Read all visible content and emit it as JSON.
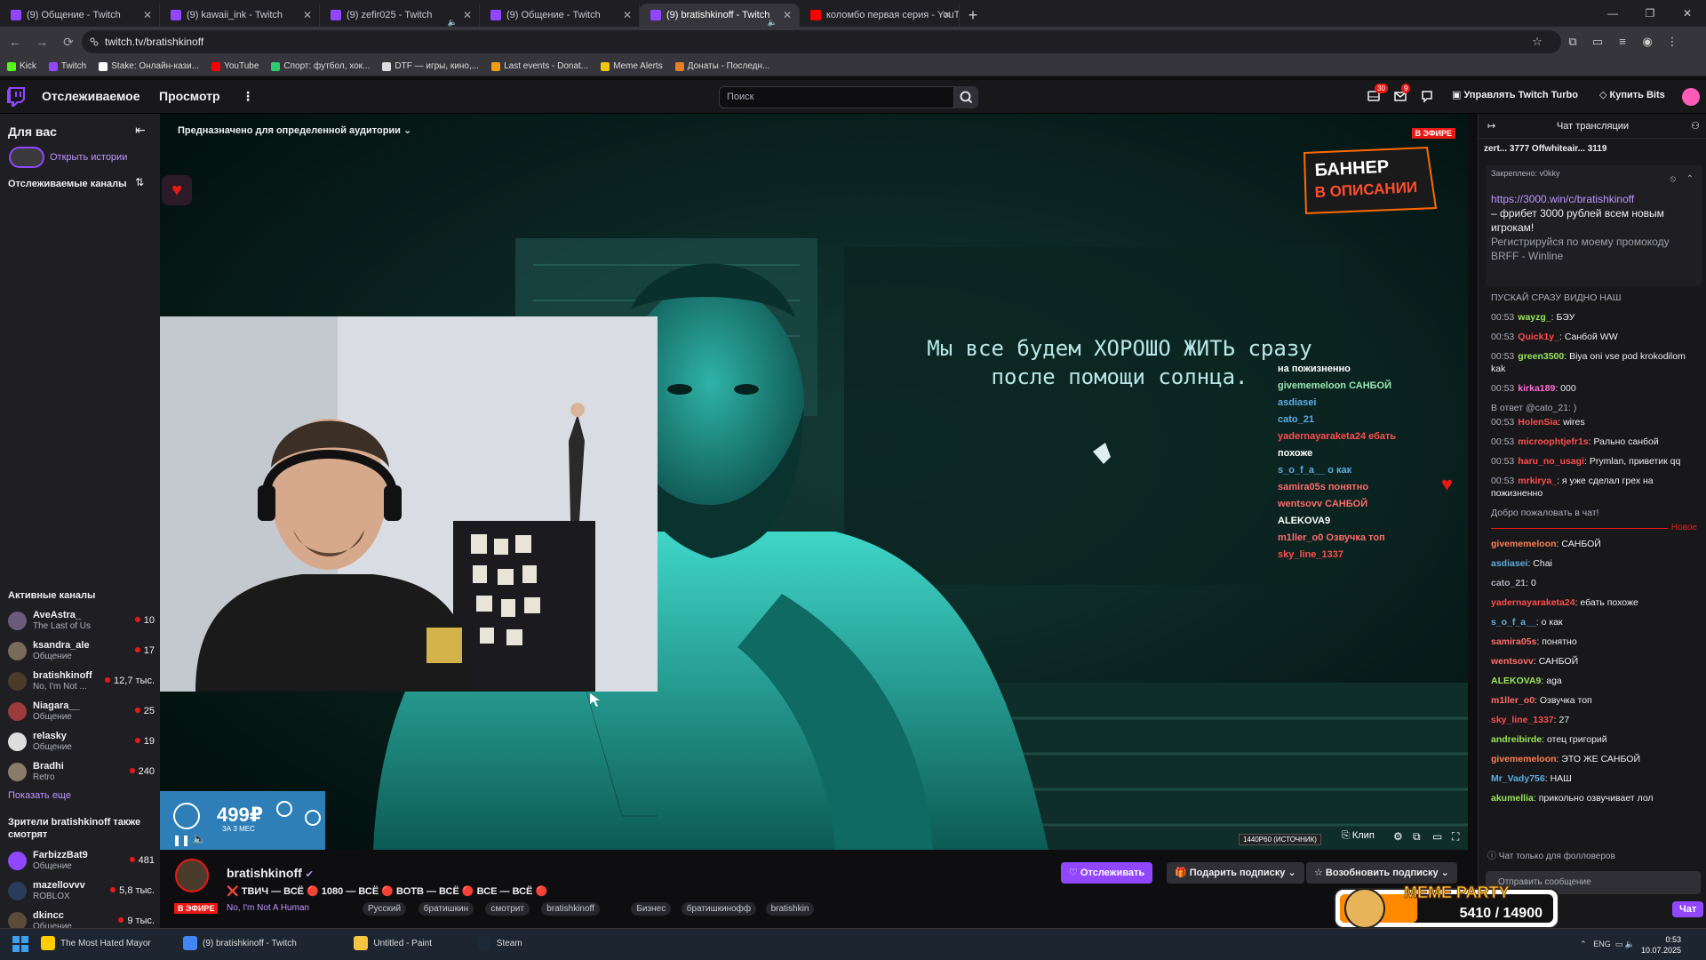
{
  "browser": {
    "tabs": [
      {
        "label": "(9) Общение - Twitch",
        "fav": "#9147ff",
        "active": false,
        "audio": false
      },
      {
        "label": "(9) kawaii_ink - Twitch",
        "fav": "#9147ff",
        "active": false,
        "audio": false
      },
      {
        "label": "(9) zefir025 - Twitch",
        "fav": "#9147ff",
        "active": false,
        "audio": true
      },
      {
        "label": "(9) Общение - Twitch",
        "fav": "#9147ff",
        "active": false,
        "audio": false
      },
      {
        "label": "(9) bratishkinoff - Twitch",
        "fav": "#9147ff",
        "active": true,
        "audio": true
      },
      {
        "label": "коломбо первая серия - YouTube",
        "fav": "#ff0000",
        "active": false,
        "audio": false
      }
    ],
    "new_tab": "+",
    "url": "twitch.tv/bratishkinoff",
    "bookmarks": [
      {
        "label": "Kick",
        "color": "#53fc18"
      },
      {
        "label": "Twitch",
        "color": "#9147ff"
      },
      {
        "label": "Stake: Онлайн-кази...",
        "color": "#ffffff"
      },
      {
        "label": "YouTube",
        "color": "#ff0000"
      },
      {
        "label": "Спорт: футбол, хок...",
        "color": "#2ecc71"
      },
      {
        "label": "DTF — игры, кино,...",
        "color": "#dddddd"
      },
      {
        "label": "Last events - Donat...",
        "color": "#f39c12"
      },
      {
        "label": "Meme Alerts",
        "color": "#f1c40f"
      },
      {
        "label": "Донаты - Последн...",
        "color": "#e67e22"
      }
    ]
  },
  "twitch_nav": {
    "following": "Отслеживаемое",
    "browse": "Просмотр",
    "more": "⋮",
    "search_placeholder": "Поиск",
    "notif_count": "30",
    "inbox_count": "9",
    "turbo": "Управлять Twitch Turbo",
    "bits": "Купить Bits"
  },
  "sidebar": {
    "title": "Для вас",
    "stories": "Открыть истории",
    "followed_label": "Отслеживаемые каналы",
    "active_label": "Активные каналы",
    "active": [
      {
        "name": "AveAstra_",
        "category": "The Last of Us",
        "viewers": "10",
        "color": "#6b5b7b"
      },
      {
        "name": "ksandra_ale",
        "category": "Общение",
        "viewers": "17",
        "color": "#7a6a5a"
      },
      {
        "name": "bratishkinoff",
        "category": "No, I'm Not ...",
        "viewers": "12,7 тыс.",
        "color": "#4a3b2b"
      },
      {
        "name": "Niagara__",
        "category": "Общение",
        "viewers": "25",
        "color": "#9c3b3b"
      },
      {
        "name": "relasky",
        "category": "Общение",
        "viewers": "19",
        "color": "#dddddd"
      },
      {
        "name": "Bradhi",
        "category": "Retro",
        "viewers": "240",
        "color": "#8a7a6a"
      }
    ],
    "show_more": "Показать еще",
    "viewers_also_label": "Зрители bratishkinoff также смотрят",
    "also": [
      {
        "name": "FarbizzBat9",
        "category": "Общение",
        "viewers": "481",
        "color": "#9147ff"
      },
      {
        "name": "mazellovvv",
        "category": "ROBLOX",
        "viewers": "5,8 тыс.",
        "color": "#2b3b5b"
      },
      {
        "name": "dkincc",
        "category": "Общение",
        "viewers": "9 тыс.",
        "color": "#5b4b3b"
      }
    ]
  },
  "video": {
    "audience": "Предназначено для определенной аудитории",
    "live": "В ЭФИРЕ",
    "banner_line1": "БАННЕР",
    "banner_line2": "В ОПИСАНИИ",
    "caption_line1": "Мы все будем ХОРОШО ЖИТЬ сразу",
    "caption_line2": "после помощи солнца.",
    "overlay_chat": [
      {
        "text": "на пожизненно",
        "color": "#ffffff"
      },
      {
        "text": "givememeloon САНБОЙ",
        "color": "#9ae6b4"
      },
      {
        "text": "asdiasei",
        "color": "#5dade2"
      },
      {
        "text": "cato_21",
        "color": "#5dade2"
      },
      {
        "text": "yadernayaraketa24 ебать",
        "color": "#ff4d4d"
      },
      {
        "text": "похоже",
        "color": "#ffffff"
      },
      {
        "text": "s_o_f_a__ о как",
        "color": "#5dade2"
      },
      {
        "text": "samira05s понятно",
        "color": "#ff6b6b"
      },
      {
        "text": "wentsovv САНБОЙ",
        "color": "#ff6b6b"
      },
      {
        "text": "ALEKOVA9",
        "color": "#ffffff"
      },
      {
        "text": "m1ller_o0 Озвучка топ",
        "color": "#ff6b6b"
      },
      {
        "text": "sky_line_1337",
        "color": "#ff4d4d"
      }
    ],
    "ad_price": "499₽",
    "ad_sub": "ЗА 3 МЕС",
    "quality": "1440P60 (ИСТОЧНИК)",
    "clip": "Клип"
  },
  "stream_info": {
    "live": "В ЭФИРЕ",
    "name": "bratishkinoff",
    "title": "❌ ТВИЧ — ВСЁ 🔴 1080 — ВСЁ 🔴 ВОТВ — ВСЁ 🔴 ВСЕ — ВСЁ 🔴",
    "game": "No, I'm Not A Human",
    "tags": [
      "Русский",
      "братишкин",
      "смотрит",
      "bratishkinoff",
      "Бизнес",
      "братишкинофф",
      "bratishkin"
    ],
    "follow": "Отслеживать",
    "gift": "Подарить подписку",
    "resub": "Возобновить подписку"
  },
  "chat": {
    "header": "Чат трансляции",
    "gifts": "zert... 3777   Offwhiteair... 3119",
    "pinned_label": "Закреплено: v0kky",
    "pinned_link": "https://3000.win/c/bratishkinoff",
    "pinned_text": "– фрибет 3000 рублей всем новым игрокам!",
    "pinned_fade": "Регистрируйся по моему промокоду BRFF - Winline",
    "cut_line": "ПУСКАЙ СРАЗУ ВИДНО НАШ",
    "messages_top": [
      {
        "time": "00:53",
        "user": "wayzg_",
        "color": "#9ae65a",
        "text": "БЭУ"
      },
      {
        "time": "00:53",
        "user": "Quick1y_",
        "color": "#ff4d4d",
        "text": "Санбой WW"
      },
      {
        "time": "00:53",
        "user": "green3500",
        "color": "#9ae65a",
        "text": "Biya oni vse pod krokodilom kak"
      },
      {
        "time": "00:53",
        "user": "kirka189",
        "color": "#ff6bd6",
        "text": "000"
      },
      {
        "time": "00:53",
        "user": "HolenSia",
        "color": "#ff4d4d",
        "text": "wires"
      },
      {
        "time": "00:53",
        "user": "microophtjefr1s",
        "color": "#ff4d4d",
        "text": "Рально санбой"
      },
      {
        "time": "00:53",
        "user": "haru_no_usagi",
        "color": "#ff4d4d",
        "text": "Prymlan, приветик qq"
      },
      {
        "time": "00:53",
        "user": "mrkirya_",
        "color": "#ff4d4d",
        "text": "я уже сделал грех на пожизненно"
      }
    ],
    "reply_note": "В ответ @cato_21: )",
    "welcome": "Добро пожаловать в чат!",
    "new_label": "Новое",
    "messages_bottom": [
      {
        "user": "givememeloon",
        "color": "#ff7f50",
        "text": "САНБОЙ"
      },
      {
        "user": "asdiasei",
        "color": "#5dade2",
        "text": "Chai"
      },
      {
        "user": "cato_21",
        "color": "#adadb8",
        "text": "0"
      },
      {
        "user": "yadernayaraketa24",
        "color": "#ff4d4d",
        "text": "ебать похоже"
      },
      {
        "user": "s_o_f_a__",
        "color": "#5dade2",
        "text": "о как"
      },
      {
        "user": "samira05s",
        "color": "#ff6b6b",
        "text": "понятно"
      },
      {
        "user": "wentsovv",
        "color": "#ff6b6b",
        "text": "САНБОЙ"
      },
      {
        "user": "ALEKOVA9",
        "color": "#9ae65a",
        "text": "aga"
      },
      {
        "user": "m1ller_o0",
        "color": "#ff6b6b",
        "text": "Озвучка топ"
      },
      {
        "user": "sky_line_1337",
        "color": "#ff4d4d",
        "text": "27"
      },
      {
        "user": "andreibirde",
        "color": "#9ae65a",
        "text": "отец григорий"
      },
      {
        "user": "givememeloon",
        "color": "#ff7f50",
        "text": "ЭТО ЖЕ САНБОЙ"
      },
      {
        "user": "Mr_Vady756",
        "color": "#5dade2",
        "text": "НАШ"
      },
      {
        "user": "akumellia",
        "color": "#9ae65a",
        "text": "прикольно озвучивает лол"
      }
    ],
    "followers_only": "Чат только для фолловеров",
    "send_placeholder": "Отправить сообщение",
    "chat_button": "Чат"
  },
  "meme_widget": {
    "title": "MEME PARTY",
    "progress": "5410 / 14900",
    "fill": 0.363
  },
  "taskbar": {
    "items": [
      "The Most Hated Mayor",
      "(9) bratishkinoff - Twitch",
      "Untitled - Paint",
      "Steam"
    ],
    "lang": "ENG",
    "time": "0:53",
    "date": "10.07.2025"
  }
}
